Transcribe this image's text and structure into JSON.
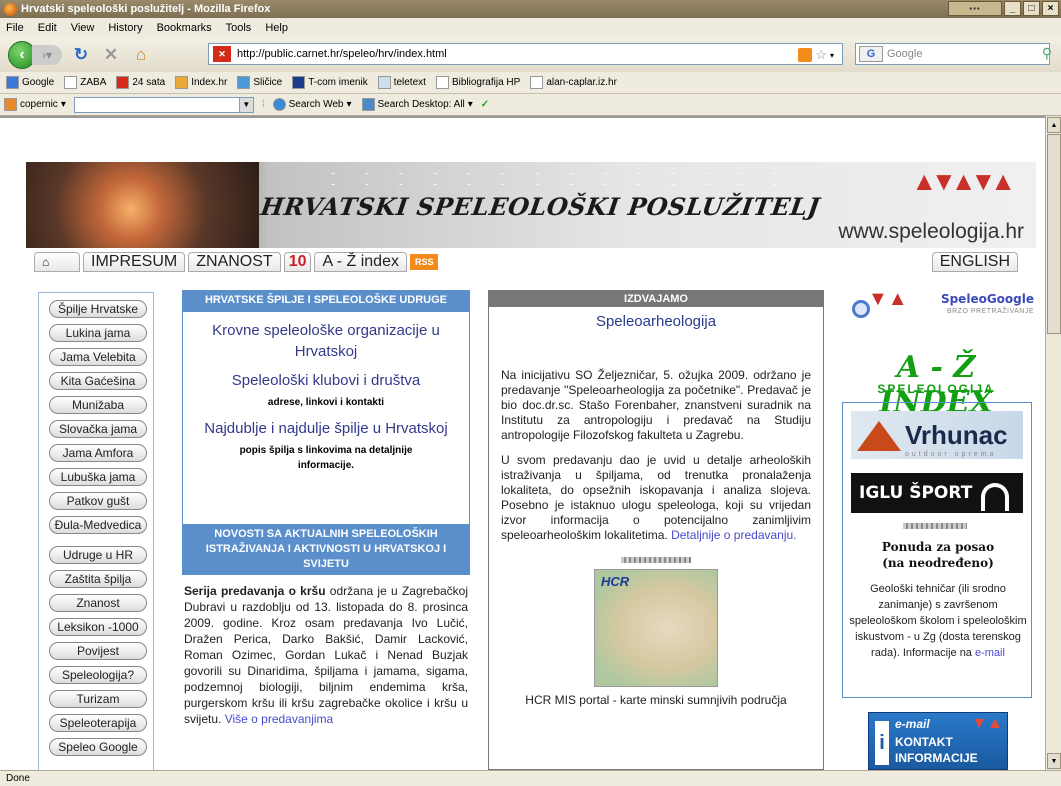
{
  "window": {
    "title": "Hrvatski speleološki poslužitelj - Mozilla Firefox"
  },
  "menu": [
    "File",
    "Edit",
    "View",
    "History",
    "Bookmarks",
    "Tools",
    "Help"
  ],
  "nav": {
    "url": "http://public.carnet.hr/speleo/hrv/index.html",
    "search_placeholder": "Google",
    "search_engine_label": "G"
  },
  "bookmarks": [
    "Google",
    "ZABA",
    "24 sata",
    "Index.hr",
    "Sličice",
    "T-com imenik",
    "teletext",
    "Bibliografija HP",
    "alan-caplar.iz.hr"
  ],
  "toolbar2": {
    "copernic": "copernic",
    "search_web": "Search Web",
    "search_desktop": "Search Desktop: All"
  },
  "status": "Done",
  "page": {
    "banner_title": "HRVATSKI SPELEOLOŠKI POSLUŽITELJ",
    "banner_url": "www.speleologija.hr",
    "tabs": [
      "IMPRESUM",
      "ZNANOST",
      "10",
      "A - Ž index"
    ],
    "rss": "RSS",
    "english": "ENGLISH",
    "left_nav": [
      "Špilje Hrvatske",
      "Lukina jama",
      "Jama Velebita",
      "Kita Gaćešina",
      "Munižaba",
      "Slovačka jama",
      "Jama Amfora",
      "Lubuška jama",
      "Patkov gušt",
      "Đula-Medvedica",
      "Udruge u HR",
      "Zaštita špilja",
      "Znanost",
      "Leksikon -1000",
      "Povijest",
      "Speleologija?",
      "Turizam",
      "Speleoterapija",
      "Speleo Google"
    ],
    "col2": {
      "header1": "HRVATSKE ŠPILJE I SPELEOLOŠKE UDRUGE",
      "link1": "Krovne speleološke organizacije u Hrvatskoj",
      "link2": "Speleološki klubovi i društva",
      "sub2": "adrese, linkovi i kontakti",
      "link3": "Najdublje i najdulje špilje u Hrvatskoj",
      "sub3": "popis špilja s linkovima na detaljnije informacije.",
      "header2": "NOVOSTI SA AKTUALNIH SPELEOLOŠKIH ISTRAŽIVANJA I AKTIVNOSTI U HRVATSKOJ I SVIJETU",
      "news_bold": "Serija predavanja o kršu",
      "news_text": " održana je u Zagrebačkoj Dubravi u razdoblju od 13. listopada do 8. prosinca 2009. godine. Kroz osam predavanja Ivo Lučić, Dražen Perica, Darko Bakšić, Damir Lacković, Roman Ozimec, Gordan Lukač i Nenad Buzjak govorili su Dinaridima, špiljama i jamama, sigama, podzemnoj biologiji, biljnim endemima krša, purgerskom kršu ili kršu zagrebačke okolice i kršu u svijetu. ",
      "news_link": "Više o predavanjima"
    },
    "col3": {
      "header": "IZDVAJAMO",
      "title": "Speleoarheologija",
      "p1": "Na inicijativu SO Željezničar, 5. ožujka 2009. održano je predavanje \"Speleoarheologija za početnike\". Predavač je bio doc.dr.sc. Stašo Forenbaher, znanstveni suradnik na Institutu za antropologiju i predavač na Studiju antropologije Filozofskog fakulteta u Zagrebu.",
      "p2": "U svom predavanju dao je uvid u detalje arheoloških istraživanja u špiljama, od trenutka pronalaženja lokaliteta, do opsežnih iskopavanja i analiza slojeva. Posebno je istaknuo ulogu speleologa, koji su vrijedan izvor informacija o potencijalno zanimljivim speleoarheološkim lokalitetima. ",
      "p2_link": "Detaljnije o predavanju.",
      "map_logo": "HCR",
      "caption": "HCR MIS portal - karte minski sumnjivih područja"
    },
    "col4": {
      "speleogoogle": "SpeleoGoogle",
      "speleogoogle_sub": "BRZO PRETRAŽIVANJE",
      "az_title": "A - Ž INDEX",
      "az_sub": "SPELEOLOGIJA",
      "vrhunac": "Vrhunac",
      "vrhunac_sub": "outdoor oprema",
      "iglu": "IGLU ŠPORT",
      "job_title1": "Ponuda za posao",
      "job_title2": "(na neodređeno)",
      "job_text": "Geološki tehničar (ili srodno zanimanje) s završenom speleološkom školom i speleološkim iskustvom - u Zg (dosta terenskog rada). Informacije na ",
      "job_link": "e-mail",
      "email_l1": "e-mail",
      "email_l2": "KONTAKT",
      "email_l3": "INFORMACIJE"
    }
  }
}
